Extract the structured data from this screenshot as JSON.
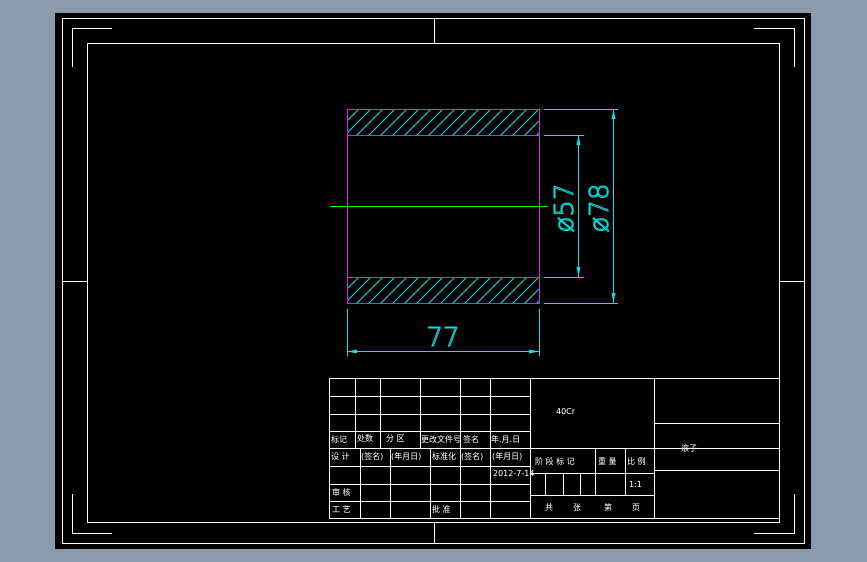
{
  "colors": {
    "background": "#8c9aad",
    "paper": "#000000",
    "frame": "#ffffff",
    "outline": "#e020e0",
    "dimension": "#00e5e5",
    "centerline": "#00ff00"
  },
  "drawing": {
    "dim_length": "77",
    "dim_inner_dia": "ø57",
    "dim_outer_dia": "ø78"
  },
  "title_block": {
    "rev_headers": [
      "标记",
      "处数",
      "分 区",
      "更改文件号",
      "签名",
      "年.月.日"
    ],
    "row_design": [
      "设 计",
      "(签名)",
      "(年月日)",
      "标准化",
      "(签名)",
      "(年月日)"
    ],
    "date": "2012-7-14",
    "review": "审 核",
    "process": "工 艺",
    "approve": "批 准",
    "material": "40Cr",
    "part_name": "滚子",
    "stage_mark": "阶 段 标 记",
    "weight": "重 量",
    "scale_label": "比 例",
    "scale": "1:1",
    "total": "共",
    "sheets": "张",
    "sheet_no": "第",
    "page": "页"
  }
}
